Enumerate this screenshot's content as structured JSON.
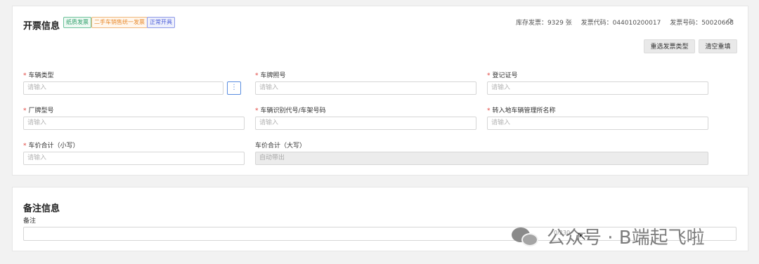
{
  "invoice": {
    "title": "开票信息",
    "tags": [
      "纸质发票",
      "二手车销售统一发票",
      "正常开具"
    ],
    "stats": {
      "stock": "库存发票：9329 张",
      "code": "发票代码：044010200017",
      "number": "发票号码：50020668"
    },
    "buttons": {
      "reselect": "重选发票类型",
      "clear": "清空重填"
    },
    "fields": {
      "vehicle_type": {
        "label": "车辆类型",
        "placeholder": "请输入"
      },
      "plate_no": {
        "label": "车牌照号",
        "placeholder": "请输入"
      },
      "reg_cert": {
        "label": "登记证号",
        "placeholder": "请输入"
      },
      "model": {
        "label": "厂牌型号",
        "placeholder": "请输入"
      },
      "vin": {
        "label": "车辆识别代号/车架号码",
        "placeholder": "请输入"
      },
      "transfer_office": {
        "label": "转入地车辆管理所名称",
        "placeholder": "请输入"
      },
      "price_small": {
        "label": "车价合计（小写）",
        "placeholder": "请输入"
      },
      "price_big": {
        "label": "车价合计（大写）",
        "value": "自动带出"
      }
    }
  },
  "remark": {
    "title": "备注信息",
    "label": "备注",
    "counter": "0/230"
  },
  "watermark": "公众号 · B端起飞啦"
}
